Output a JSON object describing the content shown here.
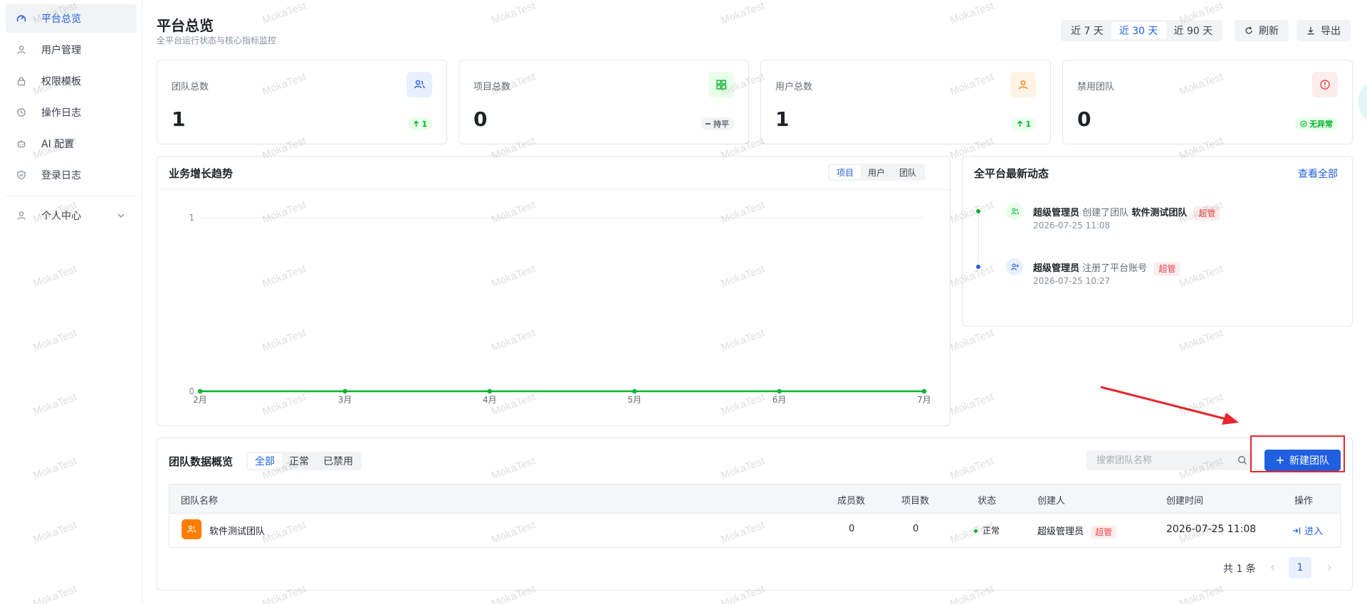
{
  "sidebar": {
    "items": [
      {
        "label": "平台总览",
        "icon": "dashboard-icon"
      },
      {
        "label": "用户管理",
        "icon": "user-icon"
      },
      {
        "label": "权限模板",
        "icon": "lock-icon"
      },
      {
        "label": "操作日志",
        "icon": "history-icon"
      },
      {
        "label": "AI 配置",
        "icon": "robot-icon"
      },
      {
        "label": "登录日志",
        "icon": "shield-icon"
      },
      {
        "label": "个人中心",
        "icon": "user-icon"
      }
    ]
  },
  "header": {
    "title": "平台总览",
    "subtitle": "全平台运行状态与核心指标监控",
    "ranges": [
      "近 7 天",
      "近 30 天",
      "近 90 天"
    ],
    "active_range": "近 30 天",
    "refresh_label": "刷新",
    "export_label": "导出"
  },
  "stats": [
    {
      "label": "团队总数",
      "value": "1",
      "badge": "1",
      "icon": "team-icon"
    },
    {
      "label": "项目总数",
      "value": "0",
      "badge": "持平",
      "icon": "grid-icon"
    },
    {
      "label": "用户总数",
      "value": "1",
      "badge": "1",
      "icon": "user-icon"
    },
    {
      "label": "禁用团队",
      "value": "0",
      "badge": "无异常",
      "icon": "alert-icon"
    }
  ],
  "colors": {
    "accent": "#1f5fe0",
    "up": "#00b42a",
    "warn": "#ff7d00",
    "danger": "#e5484d",
    "line": "#00b42a"
  },
  "trend": {
    "title": "业务增长趋势",
    "tabs": [
      "项目",
      "用户",
      "团队"
    ],
    "active_tab": "项目"
  },
  "chart_data": {
    "type": "line",
    "categories": [
      "2月",
      "3月",
      "4月",
      "5月",
      "6月",
      "7月"
    ],
    "series": [
      {
        "values": [
          0,
          0,
          0,
          0,
          0,
          0
        ]
      }
    ],
    "ytick_labels": [
      "0",
      "1"
    ],
    "ylim": [
      0,
      1
    ],
    "grid": true
  },
  "activity": {
    "title": "全平台最新动态",
    "view_all": "查看全部",
    "items": [
      {
        "actor": "超级管理员",
        "action": "创建了团队",
        "target": "软件测试团队",
        "tag": "超管",
        "time": "2026-07-25 11:08"
      },
      {
        "actor": "超级管理员",
        "action": "注册了平台账号",
        "target": "",
        "tag": "超管",
        "time": "2026-07-25 10:27"
      }
    ]
  },
  "teams": {
    "title": "团队数据概览",
    "filters": [
      "全部",
      "正常",
      "已禁用"
    ],
    "active_filter": "全部",
    "search_placeholder": "搜索团队名称",
    "new_button": "新建团队",
    "columns": [
      "团队名称",
      "成员数",
      "项目数",
      "状态",
      "创建人",
      "创建时间",
      "操作"
    ],
    "rows": [
      {
        "name": "软件测试团队",
        "members": "0",
        "projects": "0",
        "status": "正常",
        "creator": "超级管理员",
        "creator_tag": "超管",
        "created": "2026-07-25 11:08",
        "action": "进入"
      }
    ],
    "total": "共 1 条",
    "page": "1"
  },
  "watermark": "MokaTest"
}
